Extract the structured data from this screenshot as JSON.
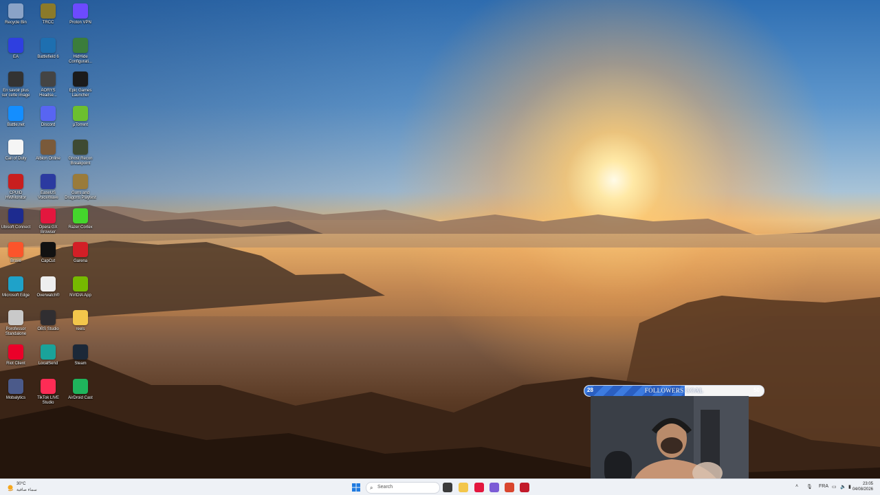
{
  "desktop_icons": [
    {
      "label": "Recycle Bin",
      "icon": "recycle-bin-icon",
      "color": "#8aa3c7"
    },
    {
      "label": "TRCC",
      "icon": "trcc-icon",
      "color": "#8b7a2a"
    },
    {
      "label": "Proton VPN",
      "icon": "proton-vpn-icon",
      "color": "#6d4aff"
    },
    {
      "label": "EA",
      "icon": "ea-icon",
      "color": "#2f3fe0"
    },
    {
      "label": "Battlefield 6",
      "icon": "battlefield-icon",
      "color": "#1e6fb0"
    },
    {
      "label": "HidHide Configurati...",
      "icon": "hidhide-icon",
      "color": "#3b7d3b"
    },
    {
      "label": "En savoir plus sur cette image",
      "icon": "camera-icon",
      "color": "#333333"
    },
    {
      "label": "AORYS Headse...",
      "icon": "headset-icon",
      "color": "#444444"
    },
    {
      "label": "Epic Games Launcher",
      "icon": "epic-games-icon",
      "color": "#1b1b1b"
    },
    {
      "label": "Battle.net",
      "icon": "battlenet-icon",
      "color": "#148eff"
    },
    {
      "label": "Discord",
      "icon": "discord-icon",
      "color": "#5865f2"
    },
    {
      "label": "µTorrent",
      "icon": "utorrent-icon",
      "color": "#6cbf2f"
    },
    {
      "label": "Call of Duty",
      "icon": "document-icon",
      "color": "#f5f5f5"
    },
    {
      "label": "Albion Online",
      "icon": "albion-icon",
      "color": "#7a5a3a"
    },
    {
      "label": "Ghost Recon Breakpoint",
      "icon": "ghost-recon-icon",
      "color": "#3e4a32"
    },
    {
      "label": "CPUID HWMonitor",
      "icon": "hwmonitor-icon",
      "color": "#c81e1e"
    },
    {
      "label": "EaseUS VoiceWave",
      "icon": "voicewave-icon",
      "color": "#2b3aa0"
    },
    {
      "label": "Guns and Dragons Playtest",
      "icon": "guns-dragons-icon",
      "color": "#9a7b3a"
    },
    {
      "label": "Ubisoft Connect",
      "icon": "ubisoft-icon",
      "color": "#1d2b8f"
    },
    {
      "label": "Opera GX Browser",
      "icon": "opera-gx-icon",
      "color": "#e3173e"
    },
    {
      "label": "Razer Cortex",
      "icon": "razer-icon",
      "color": "#44d62c"
    },
    {
      "label": "Brave",
      "icon": "brave-icon",
      "color": "#fb542b"
    },
    {
      "label": "CapCut",
      "icon": "capcut-icon",
      "color": "#111111"
    },
    {
      "label": "Garena",
      "icon": "garena-icon",
      "color": "#d31f26"
    },
    {
      "label": "Microsoft Edge",
      "icon": "edge-icon",
      "color": "#1fa2c9"
    },
    {
      "label": "Overwatch®",
      "icon": "overwatch-icon",
      "color": "#eeeeee"
    },
    {
      "label": "NVIDIA App",
      "icon": "nvidia-icon",
      "color": "#76b900"
    },
    {
      "label": "Porofessor Standalone",
      "icon": "porofessor-icon",
      "color": "#c9c9c9"
    },
    {
      "label": "OBS Studio",
      "icon": "obs-icon",
      "color": "#302e31"
    },
    {
      "label": "reels",
      "icon": "folder-icon",
      "color": "#f3c64b"
    },
    {
      "label": "Riot Client",
      "icon": "riot-icon",
      "color": "#eb0029"
    },
    {
      "label": "LocalSend",
      "icon": "localsend-icon",
      "color": "#1aa39a"
    },
    {
      "label": "Steam",
      "icon": "steam-icon",
      "color": "#1b2838"
    },
    {
      "label": "Mobalytics",
      "icon": "mobalytics-icon",
      "color": "#4b5a8a"
    },
    {
      "label": "TikTok LIVE Studio",
      "icon": "tiktok-icon",
      "color": "#fe2c55"
    },
    {
      "label": "AirDroid Cast",
      "icon": "airdroid-icon",
      "color": "#1fb45c"
    }
  ],
  "followers_goal": {
    "title": "FOLLOWERS GOAL",
    "current": "28",
    "target": "50",
    "progress": 0.56
  },
  "taskbar": {
    "weather_temp": "30°C",
    "weather_desc": "سماء صافية",
    "search_placeholder": "Search",
    "language": "FRA",
    "time": "23:05",
    "date": "04/08/2026",
    "apps": [
      {
        "icon": "task-view-icon",
        "color": "#3b3b3b"
      },
      {
        "icon": "file-explorer-icon",
        "color": "#f3c64b"
      },
      {
        "icon": "opera-gx-icon",
        "color": "#e3173e"
      },
      {
        "icon": "app-icon",
        "color": "#7c5cd6"
      },
      {
        "icon": "app-icon",
        "color": "#d9462f"
      },
      {
        "icon": "app-icon",
        "color": "#c21a2a"
      }
    ]
  }
}
